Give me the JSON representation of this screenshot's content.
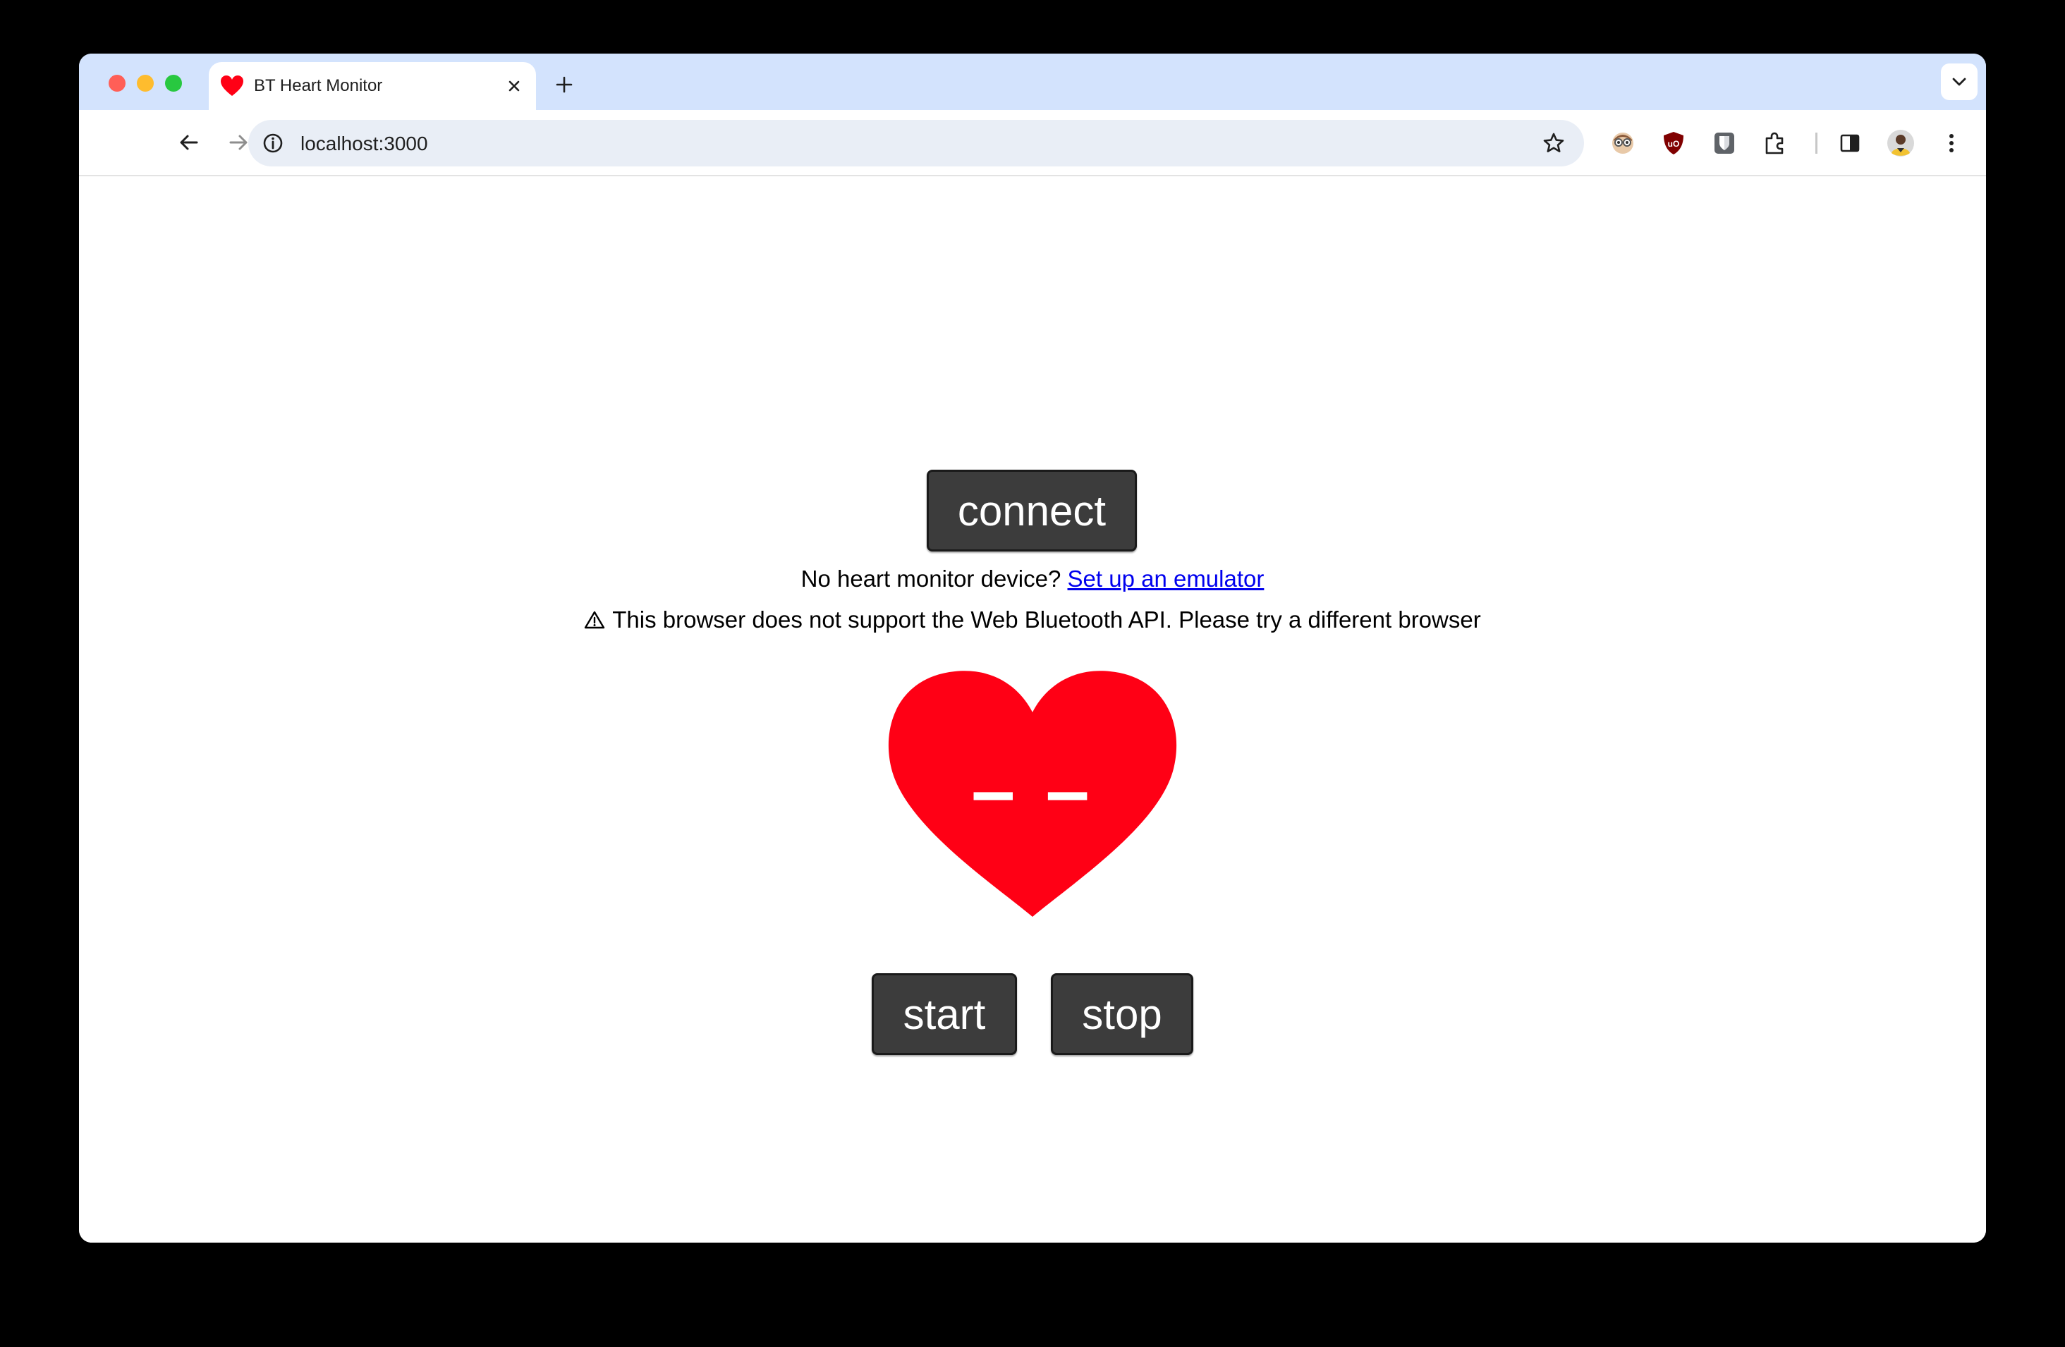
{
  "browser": {
    "tab": {
      "title": "BT Heart Monitor",
      "favicon": "heart-icon"
    },
    "address_bar": {
      "url": "localhost:3000"
    },
    "extensions": [
      "extension-avatar-icon",
      "ublock-icon",
      "bitwarden-icon",
      "extensions-puzzle-icon"
    ],
    "colors": {
      "tabstrip": "#d3e3fd",
      "omnibox": "#e9eef6"
    }
  },
  "page": {
    "connect_label": "connect",
    "no_device_text": "No heart monitor device?",
    "emulator_link": "Set up an emulator",
    "warning_text": "This browser does not support the Web Bluetooth API. Please try a different browser",
    "heart_rate": "– –",
    "start_label": "start",
    "stop_label": "stop",
    "colors": {
      "heart": "#ff0015",
      "button": "#3c3c3c",
      "link": "#0000ee"
    }
  }
}
